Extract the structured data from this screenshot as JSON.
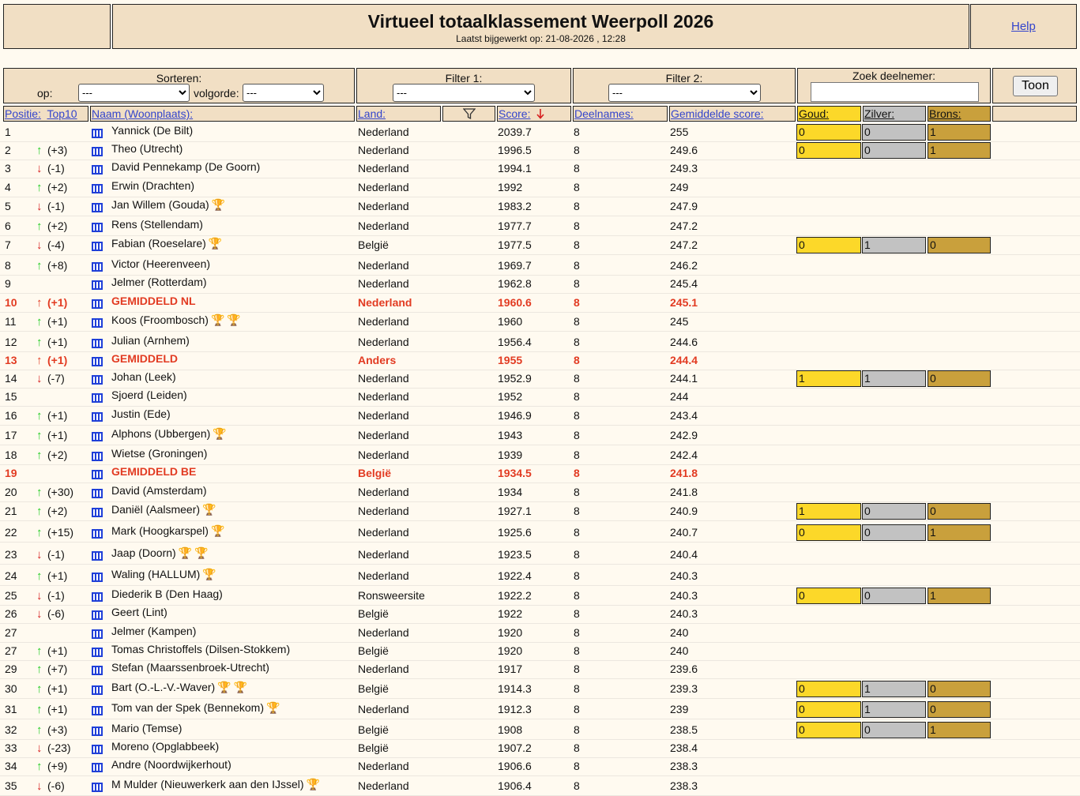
{
  "header": {
    "title": "Virtueel totaalklassement Weerpoll 2026",
    "updated": "Laatst bijgewerkt op: 21-08-2026 , 12:28",
    "help": "Help"
  },
  "controls": {
    "sort_label": "Sorteren:",
    "sort_on_label": "op:",
    "sort_on_value": "---",
    "order_label": "volgorde:",
    "order_value": "---",
    "filter1_label": "Filter 1:",
    "filter1_value": "---",
    "filter2_label": "Filter 2:",
    "filter2_value": "---",
    "search_label": "Zoek deelnemer:",
    "search_value": "",
    "show_button": "Toon"
  },
  "columns": {
    "position": "Positie:",
    "top10": "Top10",
    "name": "Naam (Woonplaats):",
    "country": "Land:",
    "score": "Score:",
    "entries": "Deelnames:",
    "average": "Gemiddelde score:",
    "gold": "Goud:",
    "silver": "Zilver:",
    "bronze": "Brons:"
  },
  "icons": {
    "filter": "funnel-icon",
    "sort_desc": "arrow-down-icon",
    "chart": "chart-icon",
    "trophy": "trophy-icon"
  },
  "colors": {
    "highlight": "#e23b22",
    "up": "#22cc22",
    "down": "#d61f1f",
    "gold": "#fcd829",
    "silver": "#c2c2c2",
    "bronze": "#c9a03c",
    "header_bg": "#f1dfc4"
  },
  "rows": [
    {
      "pos": "1",
      "dir": "",
      "change": "",
      "name": "Yannick (De Bilt)",
      "trophies": [],
      "country": "Nederland",
      "score": "2039.7",
      "entries": "8",
      "avg": "255",
      "medals": [
        "0",
        "0",
        "1"
      ],
      "hl": false
    },
    {
      "pos": "2",
      "dir": "up",
      "change": "(+3)",
      "name": "Theo (Utrecht)",
      "trophies": [],
      "country": "Nederland",
      "score": "1996.5",
      "entries": "8",
      "avg": "249.6",
      "medals": [
        "0",
        "0",
        "1"
      ],
      "hl": false
    },
    {
      "pos": "3",
      "dir": "down",
      "change": "(-1)",
      "name": "David Pennekamp (De Goorn)",
      "trophies": [],
      "country": "Nederland",
      "score": "1994.1",
      "entries": "8",
      "avg": "249.3",
      "medals": null,
      "hl": false
    },
    {
      "pos": "4",
      "dir": "up",
      "change": "(+2)",
      "name": "Erwin (Drachten)",
      "trophies": [],
      "country": "Nederland",
      "score": "1992",
      "entries": "8",
      "avg": "249",
      "medals": null,
      "hl": false
    },
    {
      "pos": "5",
      "dir": "down",
      "change": "(-1)",
      "name": "Jan Willem (Gouda)",
      "trophies": [
        "gold"
      ],
      "country": "Nederland",
      "score": "1983.2",
      "entries": "8",
      "avg": "247.9",
      "medals": null,
      "hl": false
    },
    {
      "pos": "6",
      "dir": "up",
      "change": "(+2)",
      "name": "Rens (Stellendam)",
      "trophies": [],
      "country": "Nederland",
      "score": "1977.7",
      "entries": "8",
      "avg": "247.2",
      "medals": null,
      "hl": false
    },
    {
      "pos": "7",
      "dir": "down",
      "change": "(-4)",
      "name": "Fabian (Roeselare)",
      "trophies": [
        "gold"
      ],
      "country": "België",
      "score": "1977.5",
      "entries": "8",
      "avg": "247.2",
      "medals": [
        "0",
        "1",
        "0"
      ],
      "hl": false
    },
    {
      "pos": "8",
      "dir": "up",
      "change": "(+8)",
      "name": "Victor (Heerenveen)",
      "trophies": [],
      "country": "Nederland",
      "score": "1969.7",
      "entries": "8",
      "avg": "246.2",
      "medals": null,
      "hl": false
    },
    {
      "pos": "9",
      "dir": "",
      "change": "",
      "name": "Jelmer (Rotterdam)",
      "trophies": [],
      "country": "Nederland",
      "score": "1962.8",
      "entries": "8",
      "avg": "245.4",
      "medals": null,
      "hl": false
    },
    {
      "pos": "10",
      "dir": "up",
      "change": "(+1)",
      "name": "GEMIDDELD NL",
      "trophies": [],
      "country": "Nederland",
      "score": "1960.6",
      "entries": "8",
      "avg": "245.1",
      "medals": null,
      "hl": true
    },
    {
      "pos": "11",
      "dir": "up",
      "change": "(+1)",
      "name": "Koos (Froombosch)",
      "trophies": [
        "gold",
        "gold"
      ],
      "country": "Nederland",
      "score": "1960",
      "entries": "8",
      "avg": "245",
      "medals": null,
      "hl": false
    },
    {
      "pos": "12",
      "dir": "up",
      "change": "(+1)",
      "name": "Julian (Arnhem)",
      "trophies": [],
      "country": "Nederland",
      "score": "1956.4",
      "entries": "8",
      "avg": "244.6",
      "medals": null,
      "hl": false
    },
    {
      "pos": "13",
      "dir": "up",
      "change": "(+1)",
      "name": "GEMIDDELD",
      "trophies": [],
      "country": "Anders",
      "score": "1955",
      "entries": "8",
      "avg": "244.4",
      "medals": null,
      "hl": true
    },
    {
      "pos": "14",
      "dir": "down",
      "change": "(-7)",
      "name": "Johan (Leek)",
      "trophies": [],
      "country": "Nederland",
      "score": "1952.9",
      "entries": "8",
      "avg": "244.1",
      "medals": [
        "1",
        "1",
        "0"
      ],
      "hl": false
    },
    {
      "pos": "15",
      "dir": "",
      "change": "",
      "name": "Sjoerd (Leiden)",
      "trophies": [],
      "country": "Nederland",
      "score": "1952",
      "entries": "8",
      "avg": "244",
      "medals": null,
      "hl": false
    },
    {
      "pos": "16",
      "dir": "up",
      "change": "(+1)",
      "name": "Justin (Ede)",
      "trophies": [],
      "country": "Nederland",
      "score": "1946.9",
      "entries": "8",
      "avg": "243.4",
      "medals": null,
      "hl": false
    },
    {
      "pos": "17",
      "dir": "up",
      "change": "(+1)",
      "name": "Alphons (Ubbergen)",
      "trophies": [
        "bronze"
      ],
      "country": "Nederland",
      "score": "1943",
      "entries": "8",
      "avg": "242.9",
      "medals": null,
      "hl": false
    },
    {
      "pos": "18",
      "dir": "up",
      "change": "(+2)",
      "name": "Wietse (Groningen)",
      "trophies": [],
      "country": "Nederland",
      "score": "1939",
      "entries": "8",
      "avg": "242.4",
      "medals": null,
      "hl": false
    },
    {
      "pos": "19",
      "dir": "",
      "change": "",
      "name": "GEMIDDELD BE",
      "trophies": [],
      "country": "België",
      "score": "1934.5",
      "entries": "8",
      "avg": "241.8",
      "medals": null,
      "hl": true
    },
    {
      "pos": "20",
      "dir": "up",
      "change": "(+30)",
      "name": "David (Amsterdam)",
      "trophies": [],
      "country": "Nederland",
      "score": "1934",
      "entries": "8",
      "avg": "241.8",
      "medals": null,
      "hl": false
    },
    {
      "pos": "21",
      "dir": "up",
      "change": "(+2)",
      "name": "Daniël (Aalsmeer)",
      "trophies": [
        "bronze"
      ],
      "country": "Nederland",
      "score": "1927.1",
      "entries": "8",
      "avg": "240.9",
      "medals": [
        "1",
        "0",
        "0"
      ],
      "hl": false
    },
    {
      "pos": "22",
      "dir": "up",
      "change": "(+15)",
      "name": "Mark (Hoogkarspel)",
      "trophies": [
        "silver"
      ],
      "country": "Nederland",
      "score": "1925.6",
      "entries": "8",
      "avg": "240.7",
      "medals": [
        "0",
        "0",
        "1"
      ],
      "hl": false
    },
    {
      "pos": "23",
      "dir": "down",
      "change": "(-1)",
      "name": "Jaap (Doorn)",
      "trophies": [
        "silver",
        "silver"
      ],
      "country": "Nederland",
      "score": "1923.5",
      "entries": "8",
      "avg": "240.4",
      "medals": null,
      "hl": false
    },
    {
      "pos": "24",
      "dir": "up",
      "change": "(+1)",
      "name": "Waling (HALLUM)",
      "trophies": [
        "bronze"
      ],
      "country": "Nederland",
      "score": "1922.4",
      "entries": "8",
      "avg": "240.3",
      "medals": null,
      "hl": false
    },
    {
      "pos": "25",
      "dir": "down",
      "change": "(-1)",
      "name": "Diederik B (Den Haag)",
      "trophies": [],
      "country": "Ronsweersite",
      "score": "1922.2",
      "entries": "8",
      "avg": "240.3",
      "medals": [
        "0",
        "0",
        "1"
      ],
      "hl": false
    },
    {
      "pos": "26",
      "dir": "down",
      "change": "(-6)",
      "name": "Geert (Lint)",
      "trophies": [],
      "country": "België",
      "score": "1922",
      "entries": "8",
      "avg": "240.3",
      "medals": null,
      "hl": false
    },
    {
      "pos": "27",
      "dir": "",
      "change": "",
      "name": "Jelmer (Kampen)",
      "trophies": [],
      "country": "Nederland",
      "score": "1920",
      "entries": "8",
      "avg": "240",
      "medals": null,
      "hl": false
    },
    {
      "pos": "27",
      "dir": "up",
      "change": "(+1)",
      "name": "Tomas Christoffels (Dilsen-Stokkem)",
      "trophies": [],
      "country": "België",
      "score": "1920",
      "entries": "8",
      "avg": "240",
      "medals": null,
      "hl": false
    },
    {
      "pos": "29",
      "dir": "up",
      "change": "(+7)",
      "name": "Stefan (Maarssenbroek-Utrecht)",
      "trophies": [],
      "country": "Nederland",
      "score": "1917",
      "entries": "8",
      "avg": "239.6",
      "medals": null,
      "hl": false
    },
    {
      "pos": "30",
      "dir": "up",
      "change": "(+1)",
      "name": "Bart (O.-L.-V.-Waver)",
      "trophies": [
        "gold",
        "gold"
      ],
      "country": "België",
      "score": "1914.3",
      "entries": "8",
      "avg": "239.3",
      "medals": [
        "0",
        "1",
        "0"
      ],
      "hl": false
    },
    {
      "pos": "31",
      "dir": "up",
      "change": "(+1)",
      "name": "Tom van der Spek (Bennekom)",
      "trophies": [
        "gold"
      ],
      "country": "Nederland",
      "score": "1912.3",
      "entries": "8",
      "avg": "239",
      "medals": [
        "0",
        "1",
        "0"
      ],
      "hl": false
    },
    {
      "pos": "32",
      "dir": "up",
      "change": "(+3)",
      "name": "Mario (Temse)",
      "trophies": [],
      "country": "België",
      "score": "1908",
      "entries": "8",
      "avg": "238.5",
      "medals": [
        "0",
        "0",
        "1"
      ],
      "hl": false
    },
    {
      "pos": "33",
      "dir": "down",
      "change": "(-23)",
      "name": "Moreno (Opglabbeek)",
      "trophies": [],
      "country": "België",
      "score": "1907.2",
      "entries": "8",
      "avg": "238.4",
      "medals": null,
      "hl": false
    },
    {
      "pos": "34",
      "dir": "up",
      "change": "(+9)",
      "name": "Andre (Noordwijkerhout)",
      "trophies": [],
      "country": "Nederland",
      "score": "1906.6",
      "entries": "8",
      "avg": "238.3",
      "medals": null,
      "hl": false
    },
    {
      "pos": "35",
      "dir": "down",
      "change": "(-6)",
      "name": "M Mulder (Nieuwerkerk aan den IJssel)",
      "trophies": [
        "gold"
      ],
      "country": "Nederland",
      "score": "1906.4",
      "entries": "8",
      "avg": "238.3",
      "medals": null,
      "hl": false
    }
  ]
}
